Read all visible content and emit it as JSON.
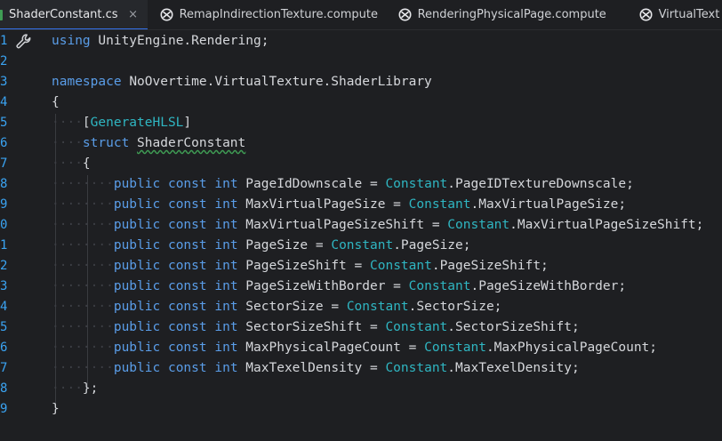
{
  "tabs": [
    {
      "label": "ShaderConstant.cs",
      "close_glyph": "×",
      "active": true
    },
    {
      "label": "RemapIndirectionTexture.compute"
    },
    {
      "label": "RenderingPhysicalPage.compute"
    },
    {
      "label": "VirtualText"
    }
  ],
  "gutter": {
    "line_numbers": [
      "1",
      "2",
      "3",
      "4",
      "5",
      "6",
      "7",
      "8",
      "9",
      "0",
      "1",
      "2",
      "3",
      "4",
      "5",
      "6",
      "7",
      "8",
      "9"
    ],
    "gutter_icon": "wrench-icon"
  },
  "code": {
    "line1_kw": "using",
    "line1_ns": "UnityEngine.Rendering;",
    "line3_kw": "namespace",
    "line3_ns": "NoOvertime.VirtualTexture.ShaderLibrary",
    "open_brace": "{",
    "close_brace": "}",
    "attr_open": "[",
    "attr_name": "GenerateHLSL",
    "attr_close": "]",
    "struct_kw": "struct",
    "struct_name": "ShaderConstant",
    "inner_close": "};",
    "kw_public": "public",
    "kw_const": "const",
    "kw_int": "int",
    "eq": "=",
    "constant_class": "Constant",
    "members": [
      {
        "name": "PageIdDownscale",
        "value": ".PageIDTextureDownscale;"
      },
      {
        "name": "MaxVirtualPageSize",
        "value": ".MaxVirtualPageSize;"
      },
      {
        "name": "MaxVirtualPageSizeShift",
        "value": ".MaxVirtualPageSizeShift;"
      },
      {
        "name": "PageSize",
        "value": ".PageSize;"
      },
      {
        "name": "PageSizeShift",
        "value": ".PageSizeShift;"
      },
      {
        "name": "PageSizeWithBorder",
        "value": ".PageSizeWithBorder;"
      },
      {
        "name": "SectorSize",
        "value": ".SectorSize;"
      },
      {
        "name": "SectorSizeShift",
        "value": ".SectorSizeShift;"
      },
      {
        "name": "MaxPhysicalPageCount",
        "value": ".MaxPhysicalPageCount;"
      },
      {
        "name": "MaxTexelDensity",
        "value": ".MaxTexelDensity;"
      }
    ]
  },
  "colors": {
    "background": "#1e1f22",
    "keyword": "#5a9de8",
    "type_name": "#2fb6c2",
    "line_number": "#3aa3f2",
    "active_tab_underline": "#3574f0"
  }
}
